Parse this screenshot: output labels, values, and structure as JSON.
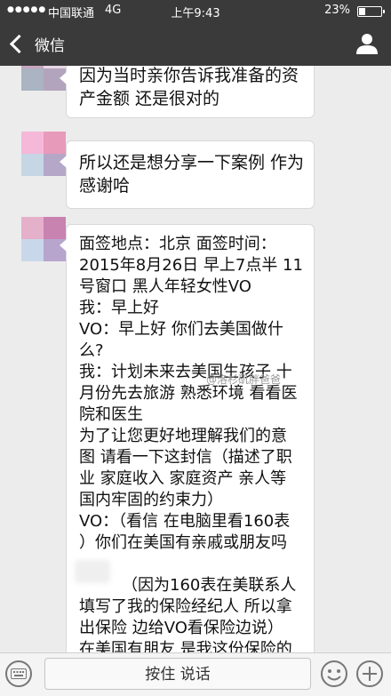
{
  "status_bar": {
    "signal": "●●●●●",
    "carrier": "中国联通",
    "network": "4G",
    "time": "上午9:43",
    "battery": "23%"
  },
  "nav": {
    "back_label": "微信"
  },
  "messages": [
    {
      "lines": [
        "因为当时亲你告诉我准备的资",
        "产金额 还是很对的"
      ]
    },
    {
      "lines": [
        "所以还是想分享一下案例 作为",
        "感谢哈"
      ]
    },
    {
      "lines": [
        "面签地点：北京 面签时间：",
        "2015年8月26日 早上7点半 11",
        "号窗口 黑人年轻女性VO",
        "我：早上好",
        "VO：早上好 你们去美国做什",
        "么?",
        "我：计划未来去美国生孩子 十",
        "月份先去旅游 熟悉环境 看看医",
        "院和医生",
        "为了让您更好地理解我们的意",
        "图 请看一下这封信（描述了职",
        "业 家庭收入 家庭资产 亲人等",
        "国内牢固的约束力）",
        "VO：（看信 在电脑里看160表",
        "）你们在美国有亲戚或朋友吗",
        "",
        "（因为160表在美联系人",
        "填写了我的保险经纪人 所以拿",
        "出保险 边给VO看保险边说）",
        "在美国有朋友 是我这份保险的"
      ]
    }
  ],
  "watermark": "@洛杉矶胖爸爸",
  "input_bar": {
    "hold_to_talk": "按住 说话"
  },
  "colors": {
    "navbar": "#3a3a3a",
    "chat_bg": "#ececec",
    "bubble": "#ffffff"
  }
}
